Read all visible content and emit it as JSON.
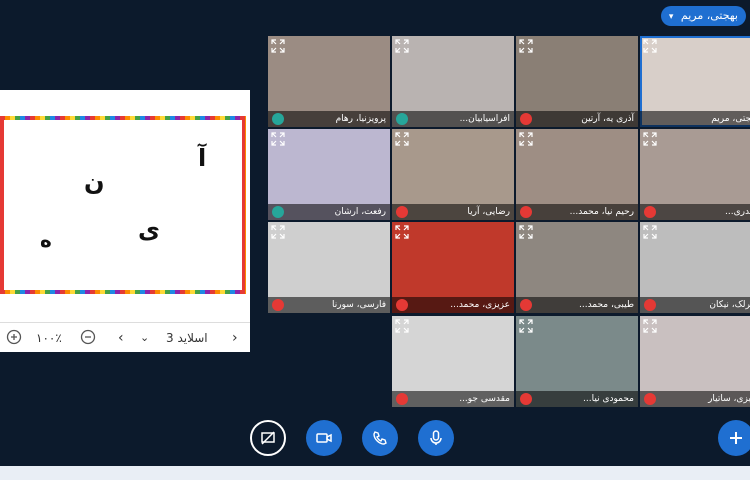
{
  "presenter": {
    "name": "بهجتی، مریم"
  },
  "slide": {
    "letters": [
      "آ",
      "ن",
      "ی",
      "ه"
    ],
    "zoom": "۱۰۰٪",
    "slide_label": "اسلاید 3"
  },
  "participants": [
    {
      "name": "پرویزنیا، رهام",
      "mic": "head"
    },
    {
      "name": "افراسیابیان...",
      "mic": "head"
    },
    {
      "name": "آذری یه، آرتین",
      "mic": "muted"
    },
    {
      "name": "بهجتی، مریم",
      "mic": "none"
    },
    {
      "name": "رفعت، ارشان",
      "mic": "head"
    },
    {
      "name": "رضایی، آریا",
      "mic": "muted"
    },
    {
      "name": "رحیم نیا، محمد...",
      "mic": "muted"
    },
    {
      "name": "حیدری...",
      "mic": "muted"
    },
    {
      "name": "فارسی، سورنا",
      "mic": "muted"
    },
    {
      "name": "عزیزی، محمد...",
      "mic": "muted"
    },
    {
      "name": "طیبی، محمد...",
      "mic": "muted"
    },
    {
      "name": "سرلک، نیکان",
      "mic": "muted"
    },
    {
      "name": "مقدسی جو...",
      "mic": "muted"
    },
    {
      "name": "محمودی نیا...",
      "mic": "muted"
    },
    {
      "name": "فایزی، ساتیار",
      "mic": "muted"
    }
  ],
  "colors": {
    "accent": "#1f6fd1",
    "muted": "#e53935",
    "headset": "#26a69a",
    "background": "#0c1a2c"
  }
}
